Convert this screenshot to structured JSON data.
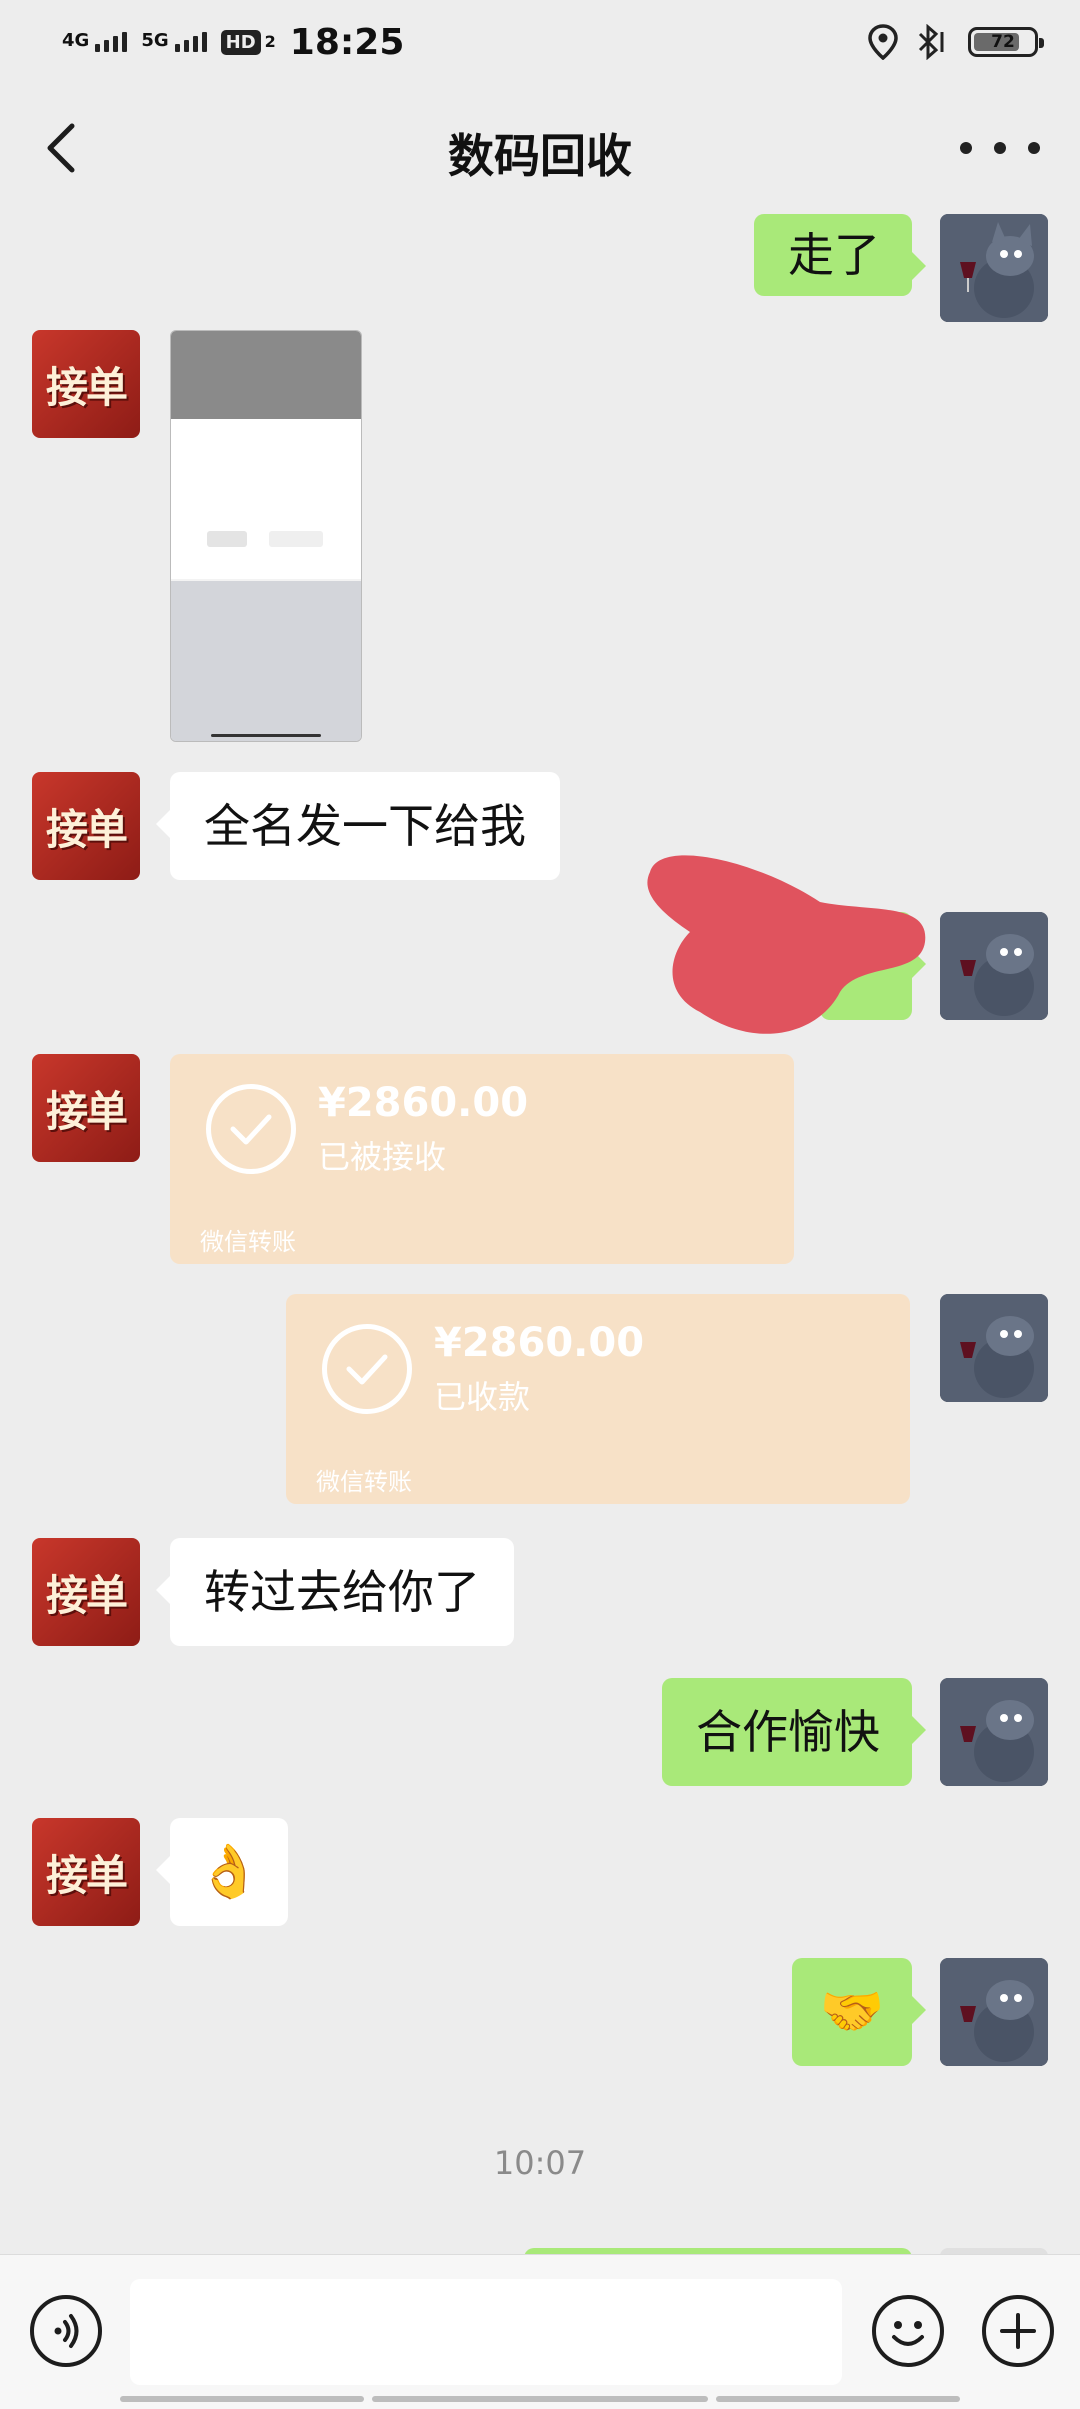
{
  "status_bar": {
    "network_1": "4G",
    "network_2": "5G",
    "hd_label": "HD",
    "hd_sub": "2",
    "time": "18:25",
    "battery": "72"
  },
  "nav": {
    "title": "数码回收",
    "back_icon": "chevron-left-icon",
    "more_icon": "more-icon"
  },
  "messages": {
    "m1_text": "走了",
    "m3_text": "全名发一下给我",
    "m5_amount": "¥2860.00",
    "m5_status": "已被接收",
    "m5_source": "微信转账",
    "m6_amount": "¥2860.00",
    "m6_status": "已收款",
    "m6_source": "微信转账",
    "m7_text": "转过去给你了",
    "m8_text": "合作愉快",
    "m9_emoji": "👌",
    "m10_emoji": "🤝"
  },
  "avatars": {
    "contact_text": "接单"
  },
  "timestamp": "10:07",
  "colors": {
    "background": "#ededed",
    "bubble_green": "#a9e979",
    "bubble_white": "#ffffff",
    "transfer": "#f7e1c7",
    "redaction": "#e0535e"
  }
}
